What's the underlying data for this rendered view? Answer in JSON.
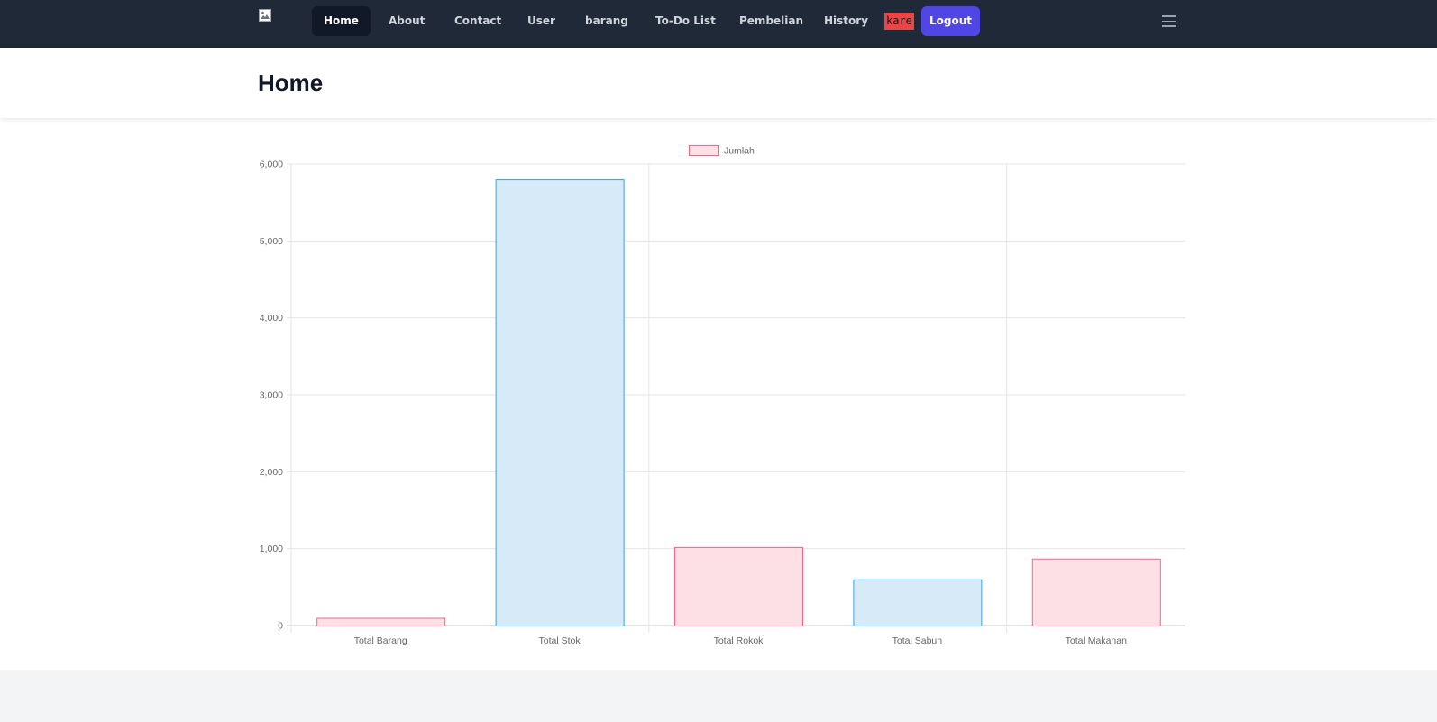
{
  "nav": {
    "links": [
      {
        "label": "Home",
        "active": true
      },
      {
        "label": "About"
      },
      {
        "label": "Contact"
      },
      {
        "label": "User"
      },
      {
        "label": "barang"
      },
      {
        "label": "To-Do List"
      },
      {
        "label": "Pembelian"
      },
      {
        "label": "History"
      }
    ],
    "user_name": "kare",
    "logout_label": "Logout",
    "icons": {
      "logo": "broken-image-icon",
      "menu": "hamburger-menu-icon"
    }
  },
  "page": {
    "title": "Home"
  },
  "colors": {
    "nav_bg": "#1f2937",
    "accent": "#4f46e5",
    "user_chip": "#ef4444",
    "bar_pink_fill": "#fde0e6",
    "bar_pink_border": "#ff6384",
    "bar_blue_fill": "#d6eaf8",
    "bar_blue_border": "#36a2eb"
  },
  "chart_data": {
    "type": "bar",
    "categories": [
      "Total Barang",
      "Total Stok",
      "Total Rokok",
      "Total Sabun",
      "Total Makanan"
    ],
    "series": [
      {
        "name": "Jumlah",
        "values": [
          100,
          5800,
          1020,
          600,
          870
        ]
      }
    ],
    "bar_colors": [
      "pink",
      "blue",
      "pink",
      "blue",
      "pink"
    ],
    "ylim": [
      0,
      6000
    ],
    "yticks": [
      "0",
      "1,000",
      "2,000",
      "3,000",
      "4,000",
      "5,000",
      "6,000"
    ],
    "legend": "top-center",
    "grid": true
  }
}
